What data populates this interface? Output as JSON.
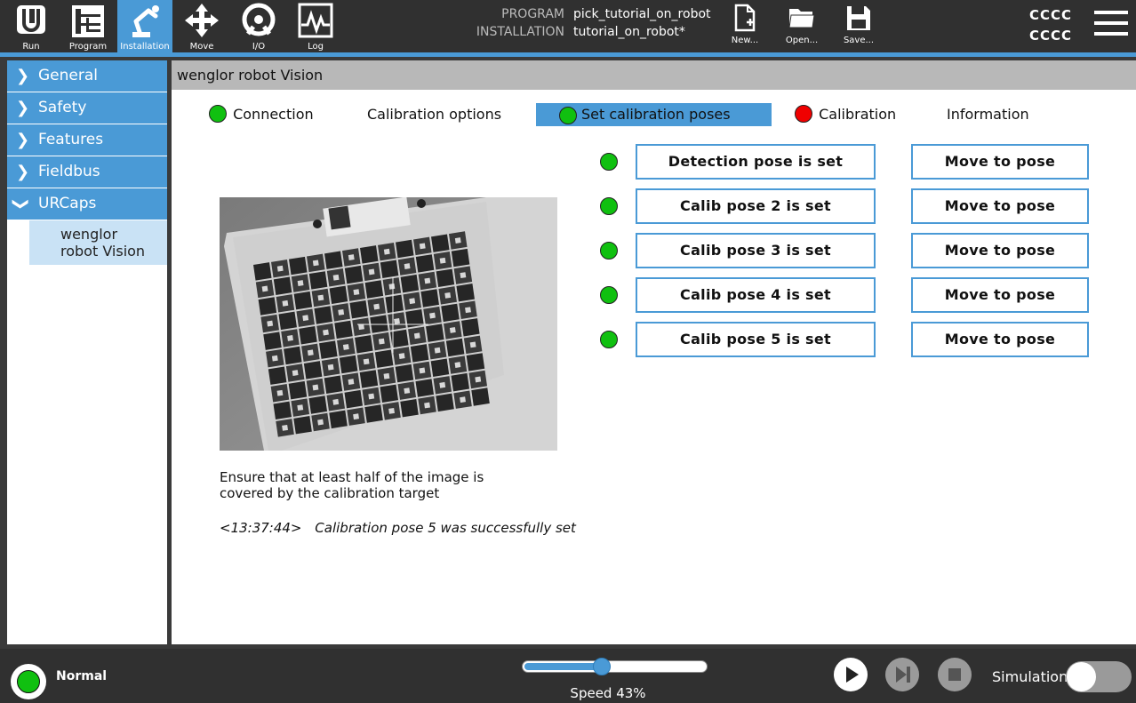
{
  "topbar": {
    "nav": [
      {
        "label": "Run",
        "icon": "ur-logo-icon"
      },
      {
        "label": "Program",
        "icon": "program-tree-icon"
      },
      {
        "label": "Installation",
        "icon": "robot-arm-icon",
        "active": true
      },
      {
        "label": "Move",
        "icon": "move-arrows-icon"
      },
      {
        "label": "I/O",
        "icon": "io-icon"
      },
      {
        "label": "Log",
        "icon": "log-pulse-icon"
      }
    ],
    "program_key": "PROGRAM",
    "program_value": "pick_tutorial_on_robot",
    "installation_key": "INSTALLATION",
    "installation_value": "tutorial_on_robot*",
    "new_label": "New...",
    "open_label": "Open...",
    "save_label": "Save...",
    "cccc_line1": "CCCC",
    "cccc_line2": "CCCC"
  },
  "sidebar": {
    "items": [
      {
        "label": "General",
        "expanded": false
      },
      {
        "label": "Safety",
        "expanded": false
      },
      {
        "label": "Features",
        "expanded": false
      },
      {
        "label": "Fieldbus",
        "expanded": false
      },
      {
        "label": "URCaps",
        "expanded": true
      }
    ],
    "sub_item_line1": "wenglor",
    "sub_item_line2": "robot Vision"
  },
  "main": {
    "title": "wenglor robot Vision",
    "tabs": [
      {
        "label": "Connection",
        "status": "green"
      },
      {
        "label": "Calibration options",
        "status": "none"
      },
      {
        "label": "Set calibration poses",
        "status": "green",
        "active": true
      },
      {
        "label": "Calibration",
        "status": "red"
      },
      {
        "label": "Information",
        "status": "none"
      }
    ],
    "poses": [
      {
        "label": "Detection pose is set",
        "status": "green",
        "move_label": "Move to pose"
      },
      {
        "label": "Calib pose 2 is set",
        "status": "green",
        "move_label": "Move to pose"
      },
      {
        "label": "Calib pose 3 is set",
        "status": "green",
        "move_label": "Move to pose"
      },
      {
        "label": "Calib pose 4 is set",
        "status": "green",
        "move_label": "Move to pose"
      },
      {
        "label": "Calib pose 5 is set",
        "status": "green",
        "move_label": "Move to pose"
      }
    ],
    "hint": "Ensure that at least half of the image is covered by the calibration target",
    "log_time": "<13:37:44>",
    "log_message": "Calibration pose 5 was successfully set"
  },
  "footer": {
    "status": "Normal",
    "speed_label": "Speed 43%",
    "speed_fraction": 0.43,
    "simulation_label": "Simulation",
    "simulation_on": false
  },
  "colors": {
    "accent": "#4a9ad6",
    "dark_bar": "#303030",
    "green": "#10c010",
    "red": "#f00000"
  }
}
